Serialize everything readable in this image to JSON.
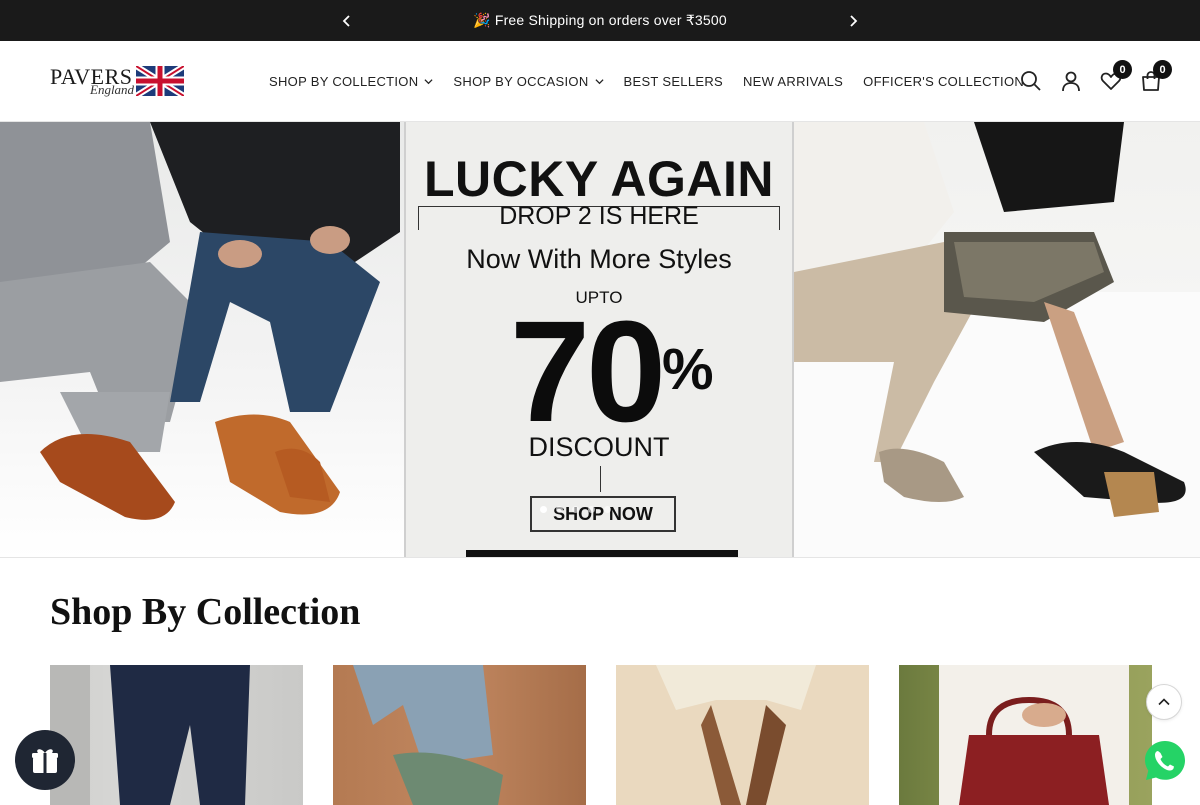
{
  "announcement": {
    "message": "🎉 Free Shipping on orders over ₹3500",
    "prev_icon": "chevron-left-icon",
    "next_icon": "chevron-right-icon"
  },
  "header": {
    "logo_text": "PAVERS",
    "logo_subtext": "England",
    "nav": [
      {
        "label": "SHOP BY COLLECTION",
        "has_dropdown": true
      },
      {
        "label": "SHOP BY OCCASION",
        "has_dropdown": true
      },
      {
        "label": "BEST SELLERS",
        "has_dropdown": false
      },
      {
        "label": "NEW ARRIVALS",
        "has_dropdown": false
      },
      {
        "label": "OFFICER'S COLLECTION",
        "has_dropdown": false
      }
    ],
    "wishlist_count": "0",
    "cart_count": "0"
  },
  "hero": {
    "line1": "LUCKY AGAIN",
    "line2": "DROP 2 IS HERE",
    "line3": "Now With More Styles",
    "line4": "UPTO",
    "line5": "70",
    "percent": "%",
    "line6": "DISCOUNT",
    "cta": "SHOP NOW",
    "slides": 5,
    "active_slide": 0
  },
  "section": {
    "title": "Shop By Collection"
  },
  "colors": {
    "announcement_bg": "#1a1a1a",
    "badge_bg": "#111111",
    "whatsapp": "#25d366",
    "fab_bg": "#1f2633"
  }
}
